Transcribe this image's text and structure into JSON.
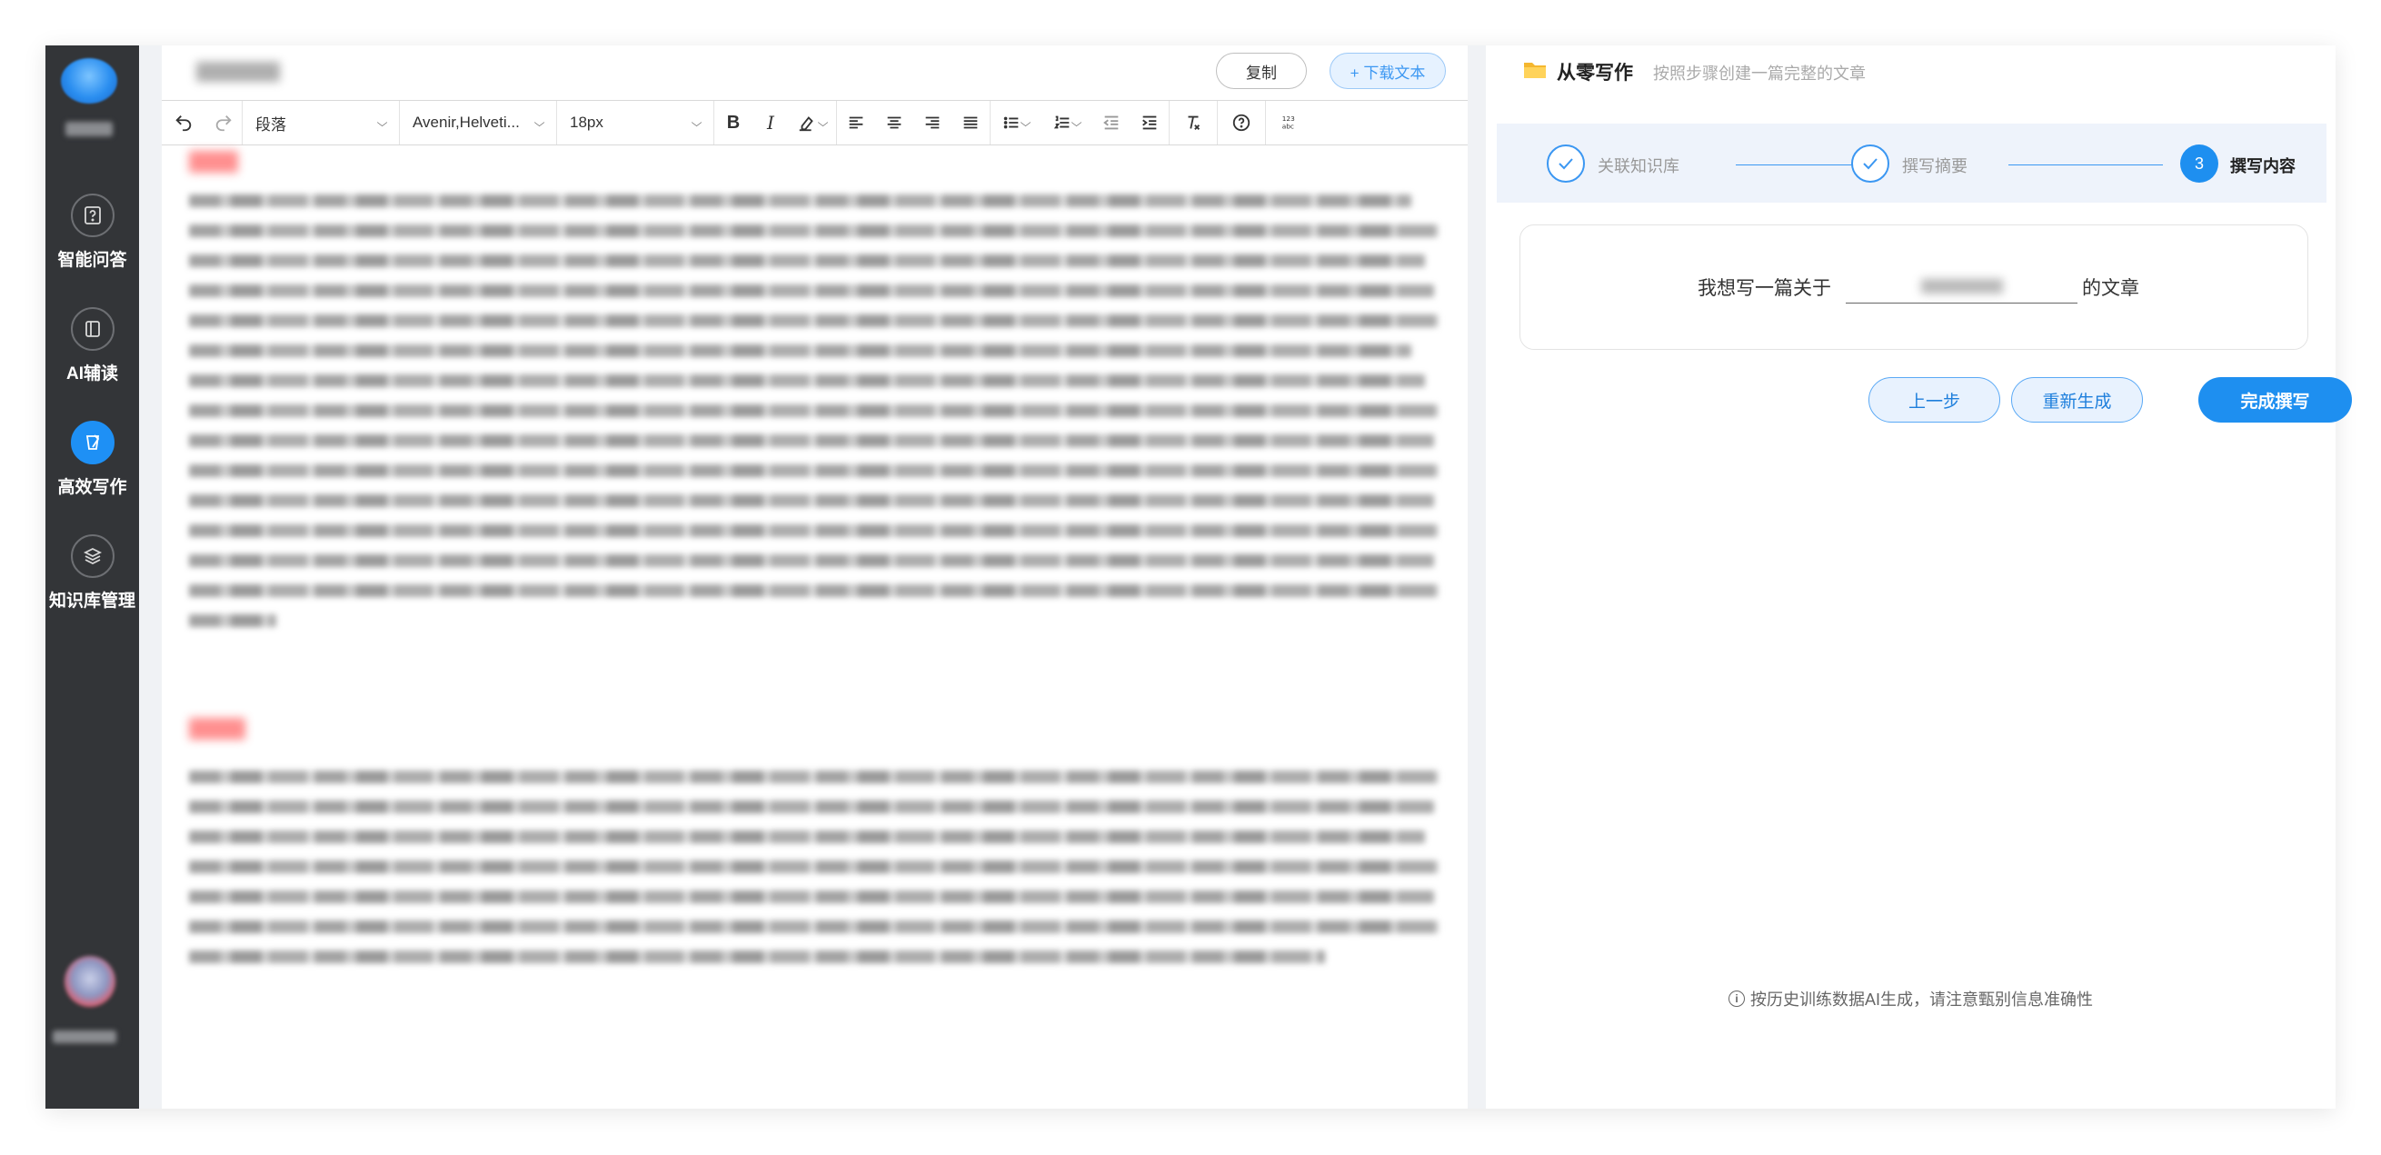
{
  "sidebar": {
    "items": [
      {
        "label": "智能问答",
        "icon": "question-icon"
      },
      {
        "label": "AI辅读",
        "icon": "book-icon"
      },
      {
        "label": "高效写作",
        "icon": "pen-icon"
      },
      {
        "label": "知识库管理",
        "icon": "layers-icon"
      }
    ],
    "active_index": 2
  },
  "editor": {
    "copy_label": "复制",
    "download_label": "+ 下载文本",
    "toolbar": {
      "paragraph": "段落",
      "font": "Avenir,Helveti...",
      "size": "18px"
    }
  },
  "right_panel": {
    "title": "从零写作",
    "subtitle": "按照步骤创建一篇完整的文章",
    "steps": [
      {
        "label": "关联知识库",
        "status": "done"
      },
      {
        "label": "撰写摘要",
        "status": "done"
      },
      {
        "number": "3",
        "label": "撰写内容",
        "status": "current"
      }
    ],
    "prompt": {
      "prefix": "我想写一篇关于",
      "suffix": "的文章"
    },
    "buttons": {
      "prev": "上一步",
      "regenerate": "重新生成",
      "finish": "完成撰写"
    },
    "disclaimer": "按历史训练数据AI生成，请注意甄别信息准确性"
  },
  "colors": {
    "sidebar_bg": "#333538",
    "accent": "#1e8ff0",
    "heading_red": "#ff6a6a"
  }
}
